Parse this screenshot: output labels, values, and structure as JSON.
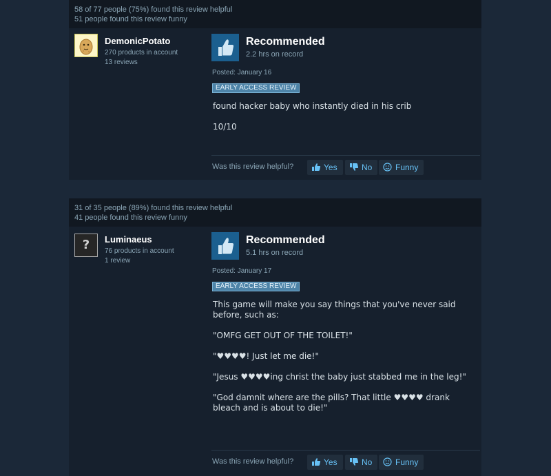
{
  "reviews": [
    {
      "helpful_text": "58 of 77 people (75%) found this review helpful",
      "funny_text": "51 people found this review funny",
      "author": {
        "name": "DemonicPotato",
        "products": "270 products in account",
        "reviews": "13 reviews"
      },
      "recommendation": "Recommended",
      "hours": "2.2 hrs on record",
      "posted": "Posted: January 16",
      "badge": "EARLY ACCESS REVIEW",
      "content": [
        "found hacker baby who instantly died in his crib",
        "10/10"
      ],
      "helpful_question": "Was this review helpful?",
      "buttons": {
        "yes": "Yes",
        "no": "No",
        "funny": "Funny"
      }
    },
    {
      "helpful_text": "31 of 35 people (89%) found this review helpful",
      "funny_text": "41 people found this review funny",
      "author": {
        "name": "Luminaeus",
        "products": "76 products in account",
        "reviews": "1 review",
        "avatar_glyph": "?"
      },
      "recommendation": "Recommended",
      "hours": "5.1 hrs on record",
      "posted": "Posted: January 17",
      "badge": "EARLY ACCESS REVIEW",
      "content": [
        "This game will make you say things that you've never said before, such as:",
        "\"OMFG GET OUT OF THE TOILET!\"",
        "\"♥♥♥♥! Just let me die!\"",
        "\"Jesus ♥♥♥♥ing christ the baby just stabbed me in the leg!\"",
        "\"God damnit where are the pills? That little ♥♥♥♥ drank bleach and is about to die!\""
      ],
      "helpful_question": "Was this review helpful?",
      "buttons": {
        "yes": "Yes",
        "no": "No",
        "funny": "Funny"
      }
    }
  ],
  "colors": {
    "background": "#1b2838",
    "card": "#16202d",
    "header": "#111821",
    "link": "#67c1f5",
    "thumb": "#1b5f8f"
  },
  "icons": [
    "thumbs-up-icon",
    "thumbs-down-icon",
    "smiley-icon",
    "potato-avatar",
    "unknown-avatar"
  ]
}
